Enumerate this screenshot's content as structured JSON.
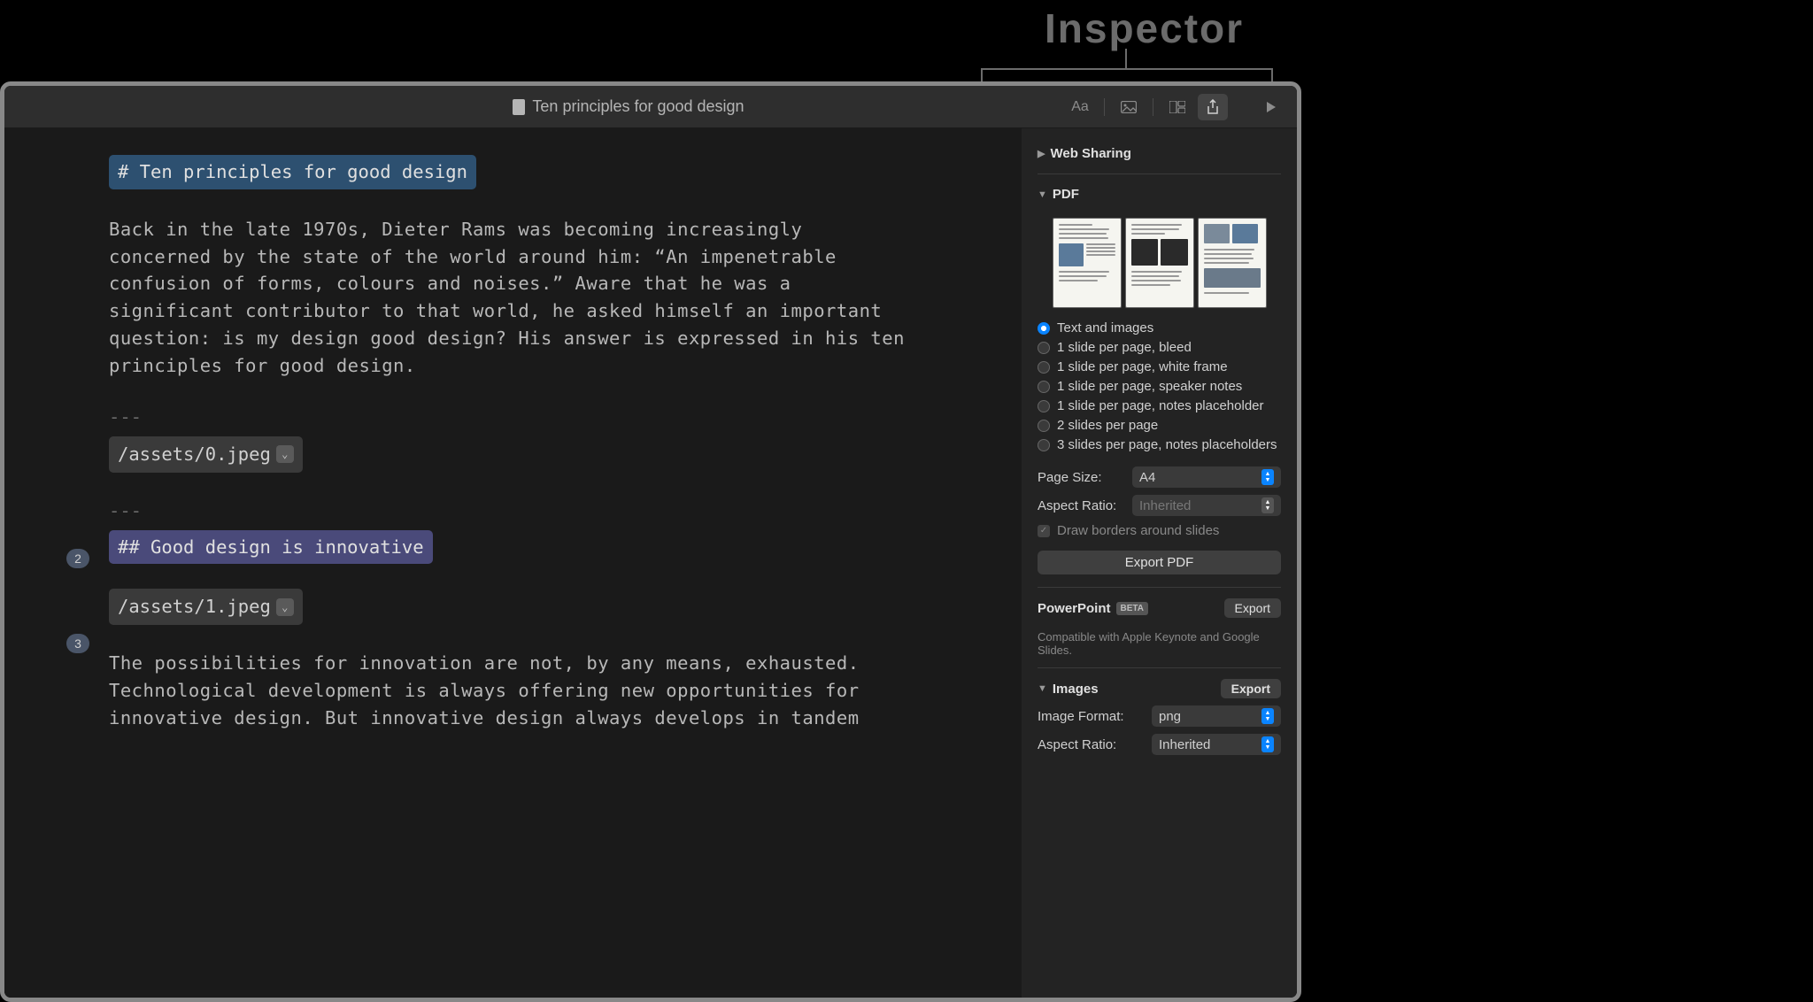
{
  "overlay": {
    "label": "Inspector"
  },
  "window": {
    "title": "Ten principles for good design"
  },
  "toolbar": {
    "font_icon": "Aa",
    "image_icon": "image",
    "layout_icon": "layout",
    "share_icon": "share",
    "play_icon": "play"
  },
  "editor": {
    "h1": "# Ten principles for good design",
    "para1": "Back in the late 1970s, Dieter Rams was becoming increasingly concerned by the state of the world around him: “An impenetrable confusion of forms, colours and noises.” Aware that he was a significant contributor to that world, he asked himself an important question: is my design good design? His answer is expressed in his ten principles for good design.",
    "hr": "---",
    "asset0": "/assets/0.jpeg",
    "badge2": "2",
    "h2": "## Good design is innovative",
    "badge3": "3",
    "asset1": "/assets/1.jpeg",
    "para2": "The possibilities for innovation are not, by any means, exhausted. Technological development is always offering new opportunities for innovative design. But innovative design always develops in tandem"
  },
  "inspector": {
    "web_sharing": "Web Sharing",
    "pdf": {
      "label": "PDF",
      "options": [
        "Text and images",
        "1 slide per page, bleed",
        "1 slide per page, white frame",
        "1 slide per page, speaker notes",
        "1 slide per page, notes placeholder",
        "2 slides per page",
        "3 slides per page, notes placeholders"
      ],
      "selected_index": 0,
      "page_size_label": "Page Size:",
      "page_size_value": "A4",
      "aspect_ratio_label": "Aspect Ratio:",
      "aspect_ratio_value": "Inherited",
      "draw_borders": "Draw borders around slides",
      "export_button": "Export PDF"
    },
    "powerpoint": {
      "label": "PowerPoint",
      "badge": "BETA",
      "export": "Export",
      "hint": "Compatible with Apple Keynote and Google Slides."
    },
    "images": {
      "label": "Images",
      "export": "Export",
      "format_label": "Image Format:",
      "format_value": "png",
      "aspect_ratio_label": "Aspect Ratio:",
      "aspect_ratio_value": "Inherited"
    }
  }
}
